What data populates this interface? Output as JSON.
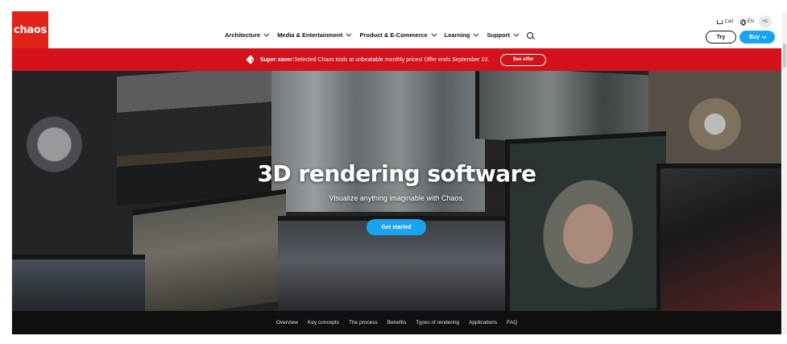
{
  "brand": {
    "logo_text": "chaos",
    "logo_color": "#e2231a"
  },
  "header": {
    "nav": [
      {
        "label": "Architecture"
      },
      {
        "label": "Media & Entertainment"
      },
      {
        "label": "Product & E-Commerce"
      },
      {
        "label": "Learning"
      },
      {
        "label": "Support"
      }
    ],
    "search_icon": "search-icon",
    "cart_label": "Cart",
    "lang_label": "EN",
    "avatar_initials": "HE",
    "try_label": "Try",
    "buy_label": "Buy"
  },
  "promo": {
    "strong": "Super saver:",
    "text": " Selected Chaos tools at unbeatable monthly prices! Offer ends September 10.",
    "button": "See offer",
    "bg_color": "#d4121c"
  },
  "hero": {
    "title": "3D rendering software",
    "subtitle": "Visualize anything imaginable with Chaos.",
    "cta": "Get started",
    "accent": "#1aa3f0"
  },
  "subnav": {
    "items": [
      "Overview",
      "Key concepts",
      "The process",
      "Benefits",
      "Types of rendering",
      "Applications",
      "FAQ"
    ]
  }
}
